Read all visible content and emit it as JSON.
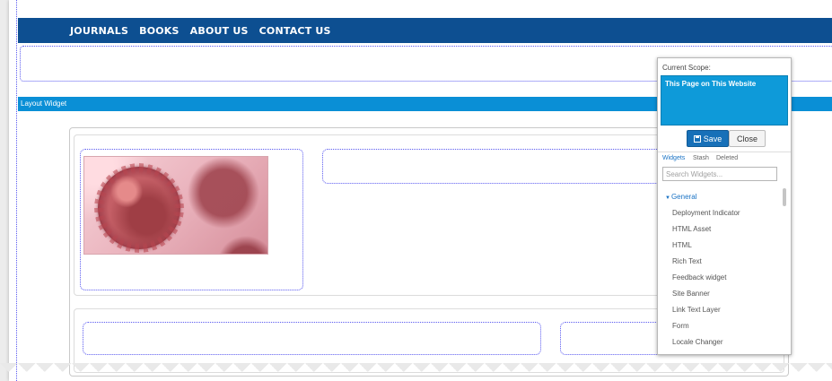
{
  "nav": {
    "items": [
      "JOURNALS",
      "BOOKS",
      "ABOUT US",
      "CONTACT US"
    ]
  },
  "layout_bar": {
    "label": "Layout Widget"
  },
  "panel": {
    "scope_label": "Current Scope:",
    "scope_value": "This Page on This Website",
    "save_label": "Save",
    "close_label": "Close",
    "tabs": [
      "Widgets",
      "Stash",
      "Deleted"
    ],
    "search_placeholder": "Search Widgets...",
    "group_label": "General",
    "widgets": [
      "Deployment Indicator",
      "HTML Asset",
      "HTML",
      "Rich Text",
      "Feedback widget",
      "Site Banner",
      "Link Text Layer",
      "Form",
      "Locale Changer"
    ]
  },
  "colors": {
    "nav_bg": "#0d4f91",
    "layout_bar_bg": "#0a8fd6",
    "scope_bg": "#0e9ad9",
    "save_bg": "#1770b8",
    "accent": "#1a73c5"
  }
}
